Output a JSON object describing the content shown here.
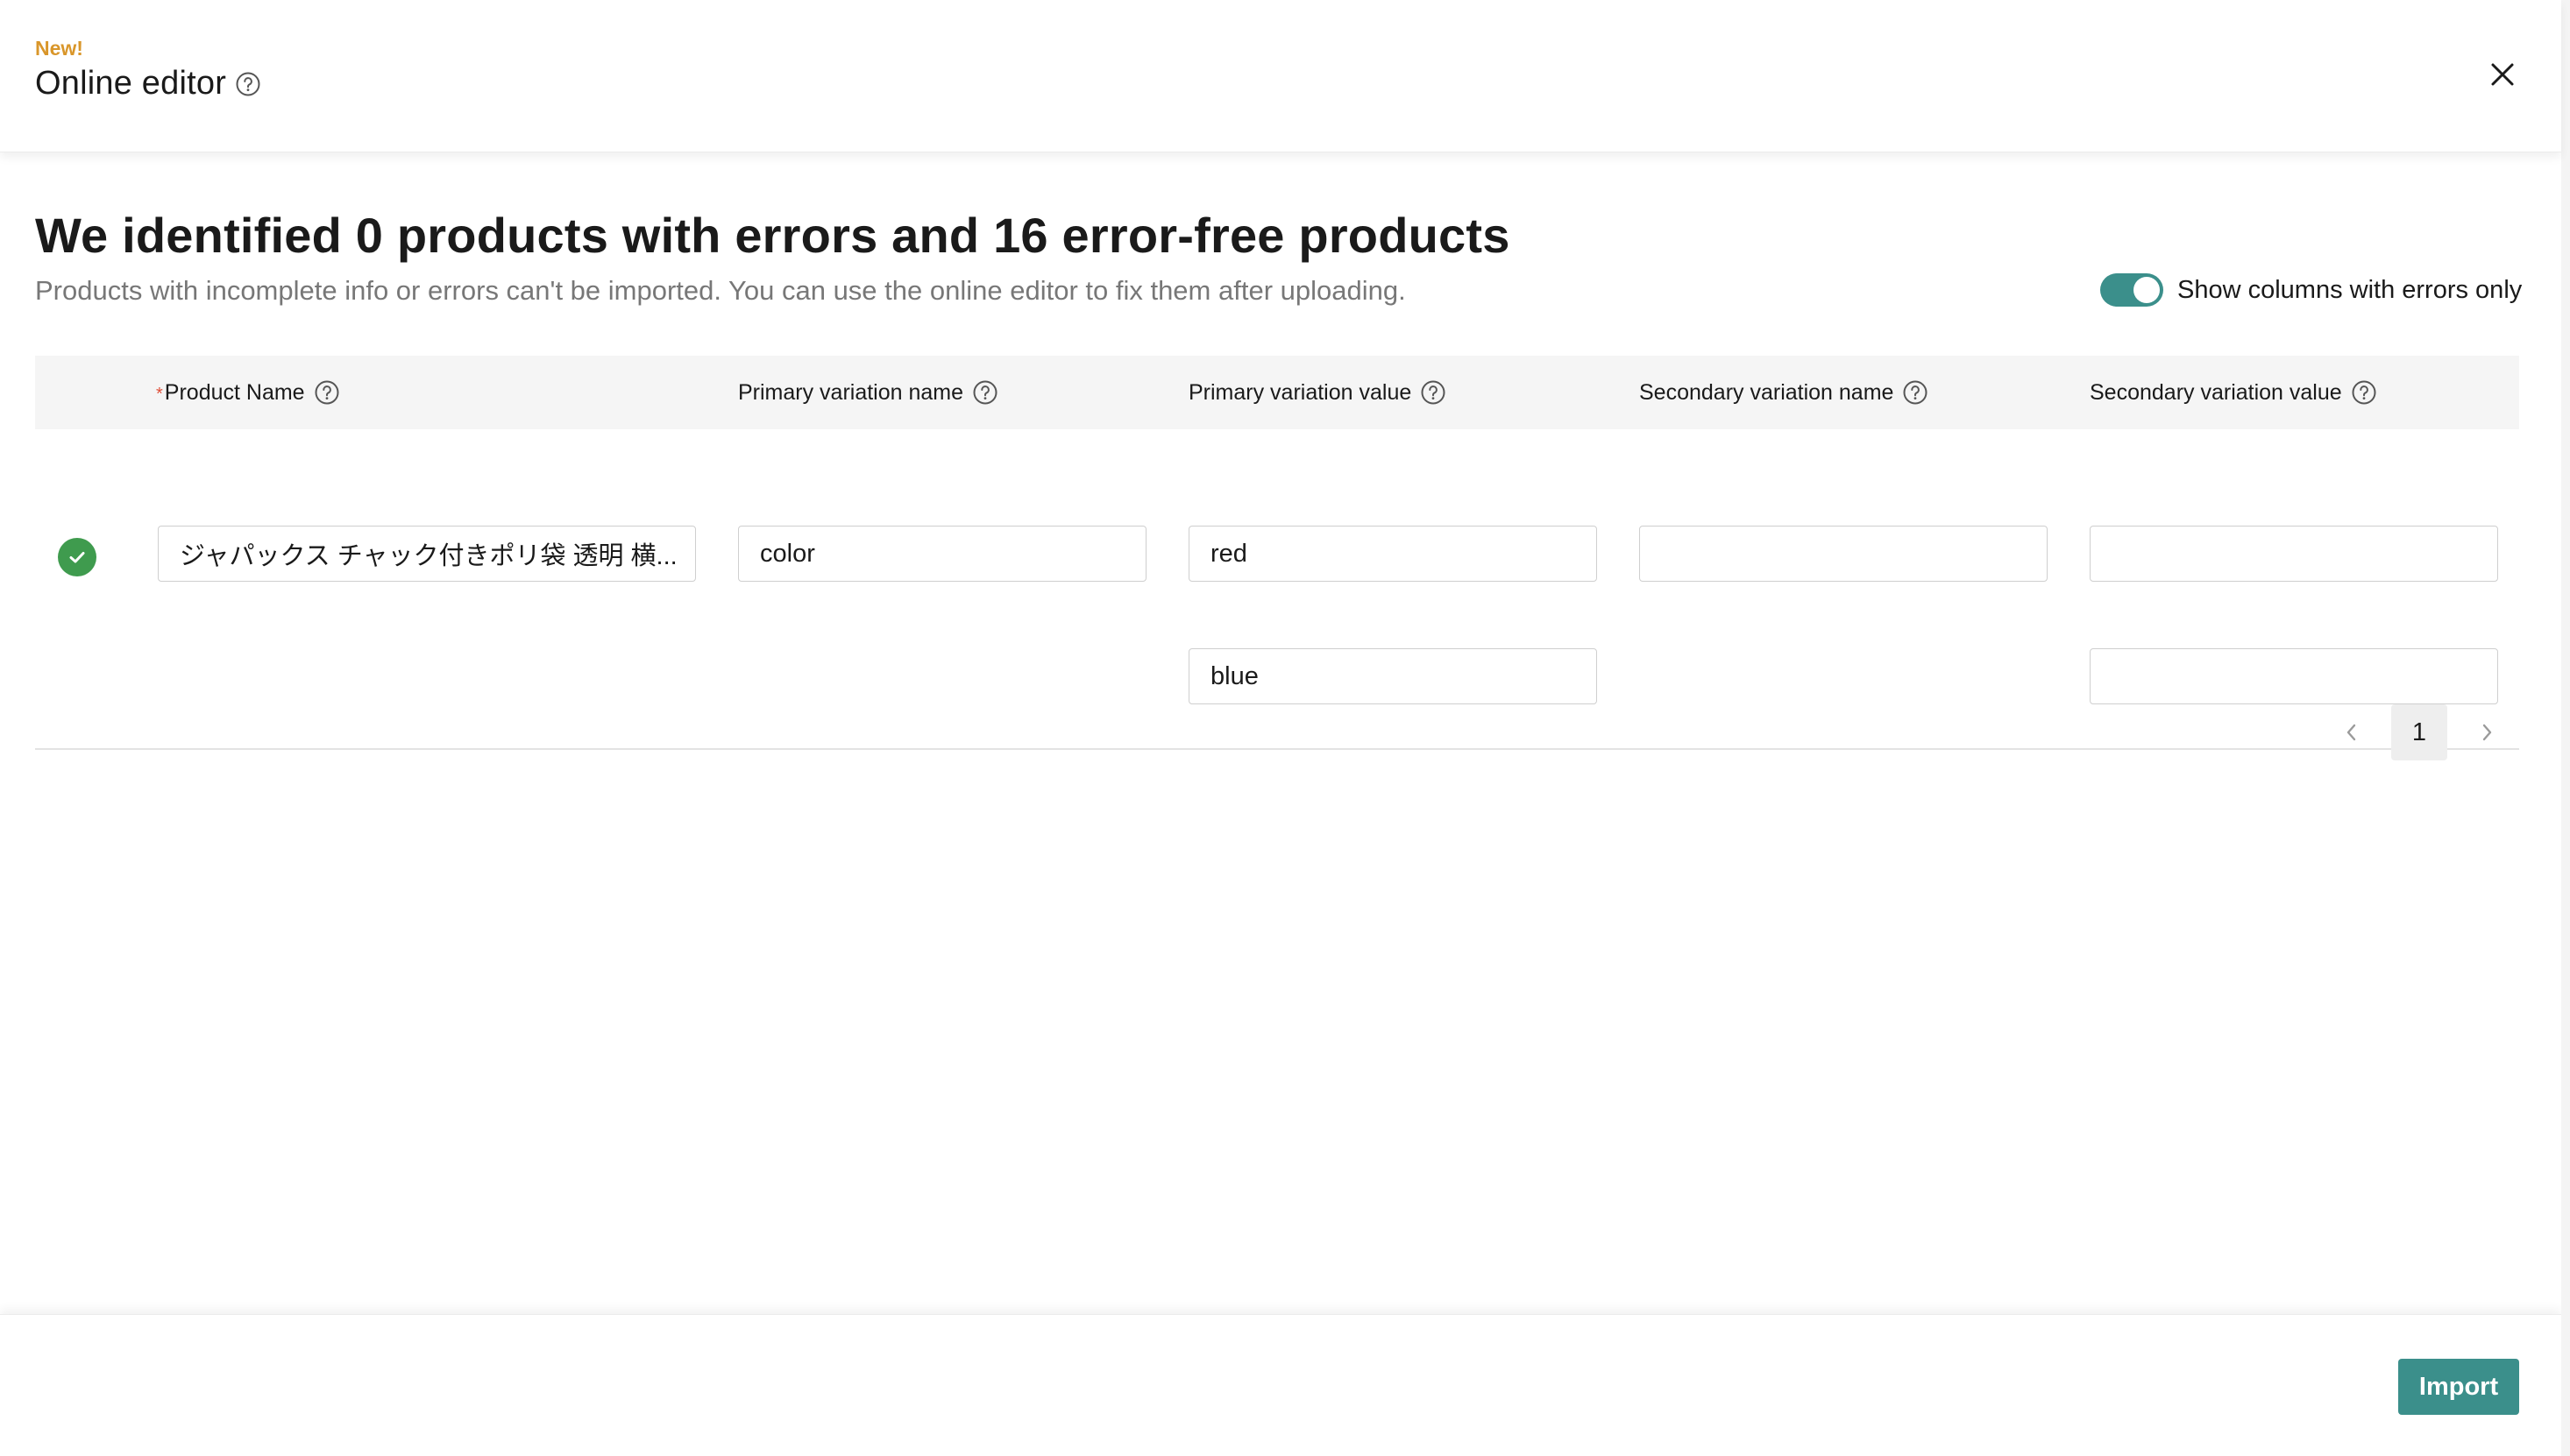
{
  "header": {
    "badge": "New!",
    "title": "Online editor"
  },
  "summary": {
    "headline": "We identified 0 products with errors and 16 error-free products",
    "subline": "Products with incomplete info or errors can't be imported. You can use the online editor to fix them after uploading."
  },
  "toggle": {
    "label": "Show columns with errors only",
    "on": true
  },
  "table": {
    "required_mark": "*",
    "columns": [
      "Product Name",
      "Primary variation name",
      "Primary variation value",
      "Secondary variation name",
      "Secondary variation value"
    ],
    "row": {
      "status": "ok",
      "product_name": "ジャパックス チャック付きポリ袋 透明 横...",
      "primary_variation_name": "color",
      "primary_variation_values": [
        "red",
        "blue"
      ],
      "secondary_variation_name": "",
      "secondary_variation_values": [
        "",
        ""
      ]
    }
  },
  "pagination": {
    "current_page": "1"
  },
  "footer": {
    "import_label": "Import"
  },
  "colors": {
    "accent": "#3b8f8b",
    "new_badge": "#d9962a",
    "success": "#3f9b4e",
    "required": "#e0503a"
  }
}
